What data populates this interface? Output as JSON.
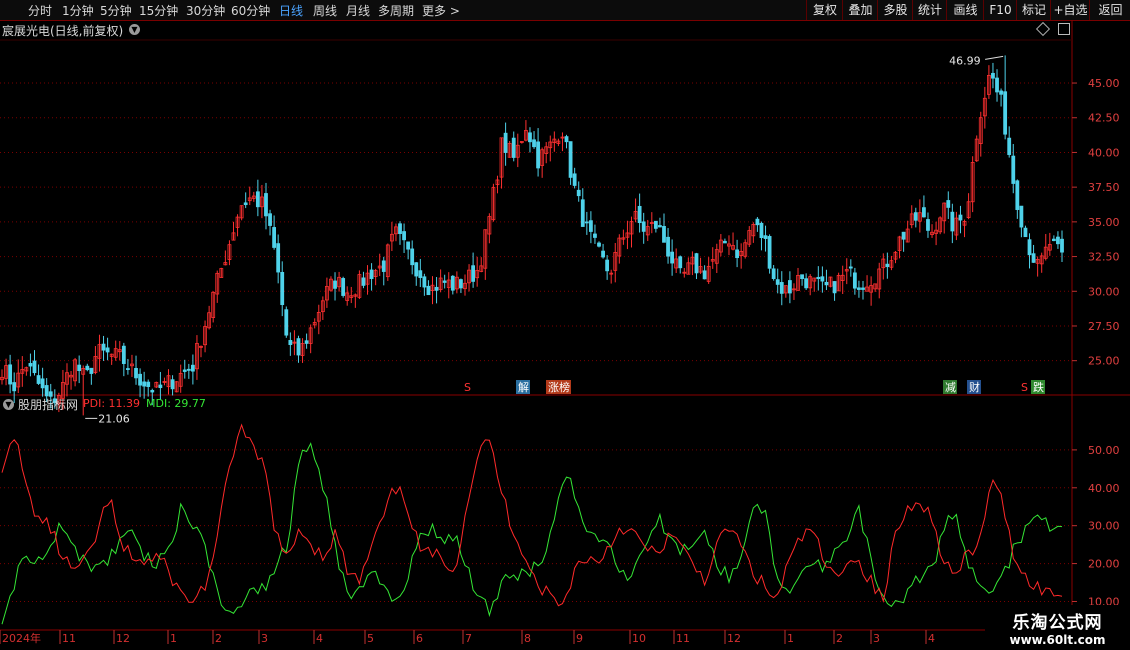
{
  "toolbar": {
    "timeframes": [
      "分时",
      "1分钟",
      "5分钟",
      "15分钟",
      "30分钟",
      "60分钟",
      "日线",
      "周线",
      "月线",
      "多周期",
      "更多 >"
    ],
    "active_timeframe": "日线",
    "right_buttons": [
      "复权",
      "叠加",
      "多股",
      "统计",
      "画线",
      "F10",
      "标记",
      "+自选",
      "返回"
    ]
  },
  "stock": {
    "title": "宸展光电(日线,前复权)"
  },
  "price_chart": {
    "y_ticks": [
      "45.00",
      "42.50",
      "40.00",
      "37.50",
      "35.00",
      "32.50",
      "30.00",
      "27.50",
      "25.00"
    ],
    "high_label": "46.99",
    "low_label": "21.06",
    "events": [
      {
        "label": "S",
        "color": "#ff3333",
        "bg": "#000000"
      },
      {
        "label": "解",
        "color": "#ffffff",
        "bg": "#2a6fa0"
      },
      {
        "label": "涨榜",
        "color": "#ffffff",
        "bg": "#b33a1a"
      },
      {
        "label": "减",
        "color": "#ffffff",
        "bg": "#2f7a2f"
      },
      {
        "label": "财",
        "color": "#ffffff",
        "bg": "#24508f"
      },
      {
        "label": "S",
        "color": "#ff3333",
        "bg": "#000000"
      },
      {
        "label": "跌",
        "color": "#ffffff",
        "bg": "#2f8a2f"
      }
    ],
    "up_color": "#ff3030",
    "down_color": "#4fd2ea"
  },
  "indicator": {
    "name": "股朋指标网",
    "pdi_label": "PDI: 11.39",
    "mdi_label": "MDI: 29.77",
    "pdi_color": "#ff2a2a",
    "mdi_color": "#35e635",
    "y_ticks": [
      "50.00",
      "40.00",
      "30.00",
      "20.00",
      "10.00"
    ]
  },
  "chart_data": [
    {
      "type": "candlestick",
      "title": "宸展光电(日线,前复权)",
      "ylim": [
        22.6,
        48.1
      ],
      "high": 46.99,
      "low": 21.06,
      "x_labels": [
        "2024年",
        "11",
        "12",
        "1",
        "2",
        "3",
        "4",
        "5",
        "6",
        "7",
        "8",
        "9",
        "10",
        "11",
        "12",
        "1",
        "2",
        "3",
        "4"
      ],
      "close_path": [
        24.5,
        23.2,
        24.8,
        23.4,
        21.9,
        22.9,
        25.0,
        23.6,
        25.6,
        25.4,
        25.2,
        24.2,
        23.4,
        22.8,
        23.4,
        24.0,
        24.6,
        27.5,
        30.5,
        33.2,
        36.2,
        36.8,
        36.1,
        32.4,
        26.0,
        25.5,
        27.4,
        29.6,
        30.8,
        30.0,
        30.5,
        31.4,
        31.8,
        34.2,
        32.8,
        31.5,
        30.2,
        30.7,
        30.4,
        30.8,
        31.6,
        35.5,
        40.8,
        39.5,
        42.0,
        39.5,
        40.4,
        41.9,
        37.6,
        34.6,
        32.8,
        31.3,
        33.7,
        35.4,
        34.4,
        34.8,
        32.8,
        30.9,
        31.9,
        31.4,
        32.6,
        33.9,
        32.5,
        34.9,
        33.8,
        30.5,
        30.0,
        31.1,
        30.6,
        30.1,
        30.6,
        31.3,
        30.6,
        31.0,
        31.7,
        33.2,
        34.5,
        35.5,
        34.2,
        36.1,
        34.5,
        35.8,
        42.5,
        45.8,
        43.2,
        37.5,
        33.8,
        31.6,
        33.5,
        32.4
      ],
      "series": [
        {
          "name": "PDI",
          "last_value": 11.39
        },
        {
          "name": "MDI",
          "last_value": 29.77
        }
      ]
    },
    {
      "type": "line",
      "title": "股朋指标网",
      "ylim": [
        3,
        60
      ],
      "series": [
        {
          "name": "PDI",
          "values": [
            44,
            55,
            40,
            32,
            30,
            22,
            18,
            20,
            28,
            38,
            24,
            22,
            20,
            22,
            18,
            12,
            10,
            14,
            24,
            45,
            56,
            50,
            46,
            28,
            20,
            30,
            25,
            22,
            28,
            18,
            15,
            24,
            32,
            40,
            36,
            24,
            22,
            22,
            18,
            35,
            50,
            52,
            38,
            28,
            22,
            14,
            12,
            8,
            18,
            22,
            20,
            25,
            30,
            28,
            24,
            22,
            28,
            24,
            20,
            16,
            24,
            30,
            25,
            18,
            14,
            10,
            20,
            26,
            30,
            20,
            16,
            22,
            20,
            15,
            10,
            28,
            34,
            38,
            32,
            22,
            16,
            22,
            24,
            42,
            36,
            22,
            16,
            14,
            12,
            11.39
          ]
        },
        {
          "name": "MDI",
          "values": [
            4,
            15,
            22,
            20,
            26,
            30,
            24,
            20,
            18,
            22,
            26,
            28,
            22,
            20,
            24,
            34,
            30,
            26,
            12,
            8,
            10,
            12,
            14,
            18,
            26,
            48,
            52,
            40,
            24,
            12,
            14,
            18,
            14,
            10,
            16,
            26,
            30,
            24,
            28,
            20,
            10,
            8,
            14,
            18,
            16,
            20,
            26,
            42,
            40,
            30,
            26,
            24,
            16,
            18,
            26,
            32,
            28,
            24,
            26,
            28,
            20,
            16,
            22,
            34,
            34,
            18,
            12,
            16,
            22,
            18,
            24,
            28,
            34,
            20,
            12,
            10,
            12,
            16,
            18,
            28,
            34,
            20,
            14,
            10,
            16,
            24,
            30,
            34,
            30,
            29.77
          ]
        }
      ]
    }
  ]
}
